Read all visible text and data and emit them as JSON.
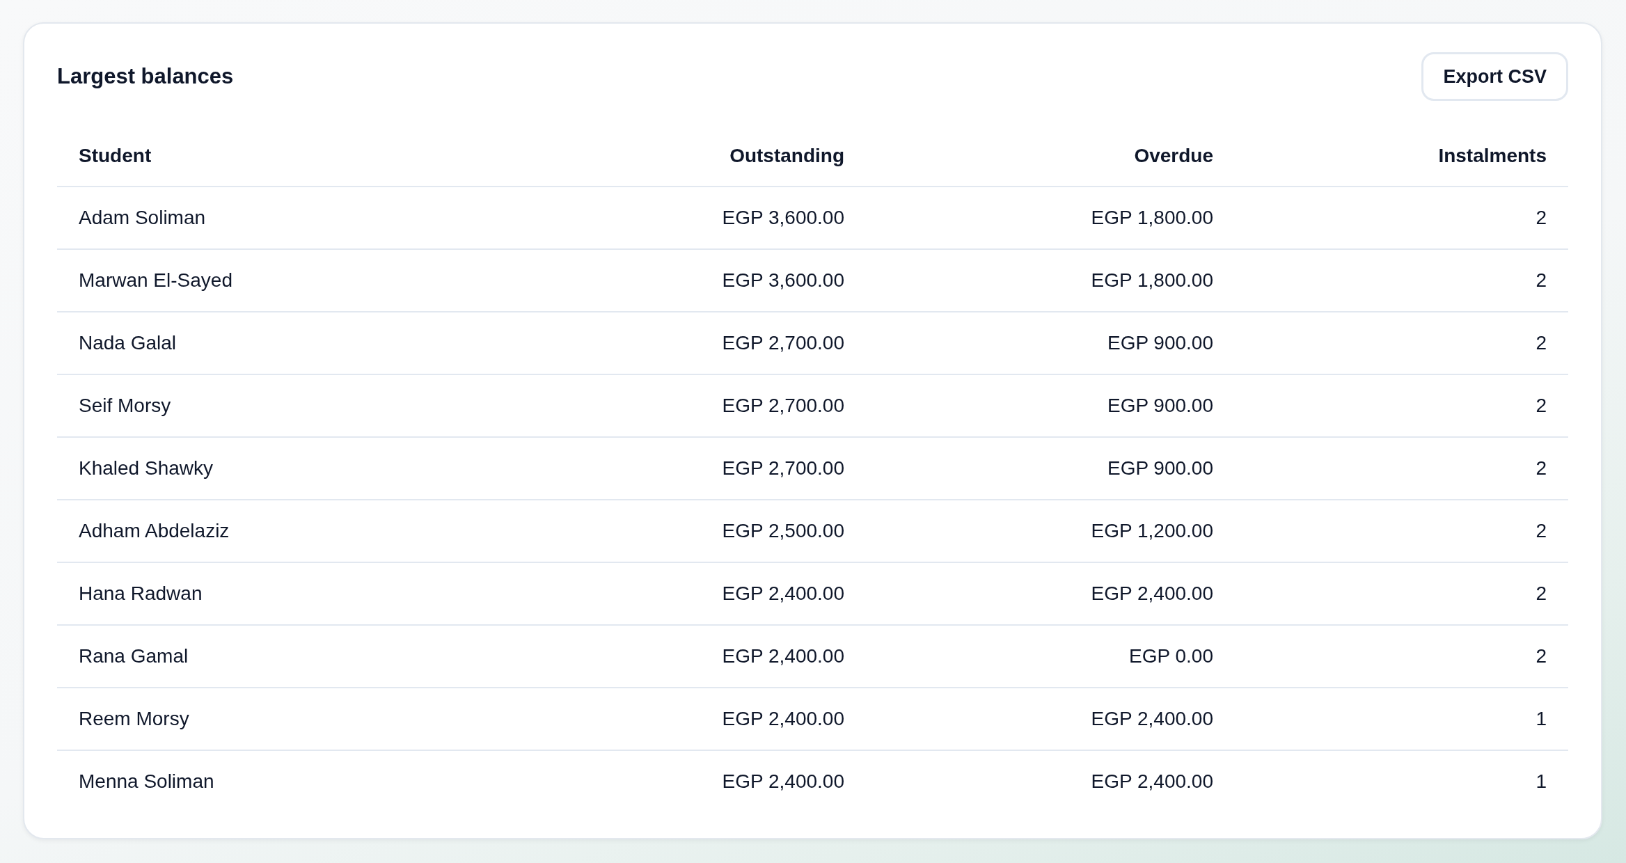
{
  "card": {
    "title": "Largest balances",
    "export_button": "Export CSV"
  },
  "table": {
    "columns": [
      "Student",
      "Outstanding",
      "Overdue",
      "Instalments"
    ],
    "rows": [
      [
        "Adam Soliman",
        "EGP 3,600.00",
        "EGP 1,800.00",
        "2"
      ],
      [
        "Marwan El-Sayed",
        "EGP 3,600.00",
        "EGP 1,800.00",
        "2"
      ],
      [
        "Nada Galal",
        "EGP 2,700.00",
        "EGP 900.00",
        "2"
      ],
      [
        "Seif Morsy",
        "EGP 2,700.00",
        "EGP 900.00",
        "2"
      ],
      [
        "Khaled Shawky",
        "EGP 2,700.00",
        "EGP 900.00",
        "2"
      ],
      [
        "Adham Abdelaziz",
        "EGP 2,500.00",
        "EGP 1,200.00",
        "2"
      ],
      [
        "Hana Radwan",
        "EGP 2,400.00",
        "EGP 2,400.00",
        "2"
      ],
      [
        "Rana Gamal",
        "EGP 2,400.00",
        "EGP 0.00",
        "2"
      ],
      [
        "Reem Morsy",
        "EGP 2,400.00",
        "EGP 2,400.00",
        "1"
      ],
      [
        "Menna Soliman",
        "EGP 2,400.00",
        "EGP 2,400.00",
        "1"
      ]
    ]
  }
}
